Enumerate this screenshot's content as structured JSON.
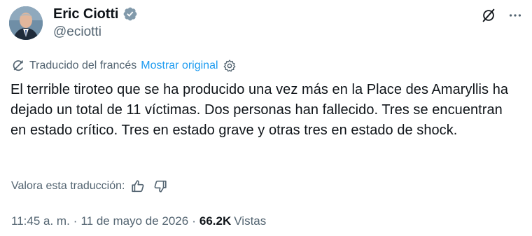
{
  "author": {
    "display_name": "Eric Ciotti",
    "handle": "@eciotti"
  },
  "translation": {
    "label": "Traducido del francés",
    "show_original": "Mostrar original"
  },
  "tweet": {
    "text": "El terrible tiroteo que se ha producido una vez más en la Place des Amaryllis ha dejado un total de 11 víctimas. Dos personas han fallecido. Tres se encuentran en estado crítico. Tres en estado grave y otras tres en estado de shock."
  },
  "rating": {
    "label": "Valora esta traducción:"
  },
  "meta": {
    "time": "11:45 a. m.",
    "separator1": "·",
    "date": "11 de mayo de 2026",
    "separator2": "·",
    "views_count": "66.2K",
    "views_label": "Vistas"
  },
  "icons": {
    "verified": "verified-badge-icon",
    "grok": "grok-icon",
    "more": "more-icon",
    "translate": "translate-icon",
    "settings": "gear-icon",
    "thumbs_up": "thumbs-up-icon",
    "thumbs_down": "thumbs-down-icon"
  },
  "colors": {
    "accent": "#1d9bf0",
    "secondary_text": "#536471",
    "primary_text": "#0f1419",
    "verified_badge": "#829aab"
  }
}
